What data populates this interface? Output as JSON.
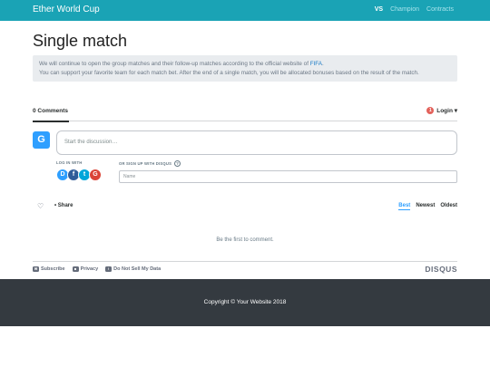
{
  "navbar": {
    "brand": "Ether World Cup",
    "links": [
      {
        "label": "VS",
        "active": true
      },
      {
        "label": "Champion",
        "active": false
      },
      {
        "label": "Contracts",
        "active": false
      }
    ]
  },
  "page": {
    "title": "Single match",
    "notice_line1_prefix": "We will continue to open the group matches and their follow-up matches according to the official website of ",
    "notice_link": "FIFA",
    "notice_line1_suffix": ".",
    "notice_line2": "You can support your favorite team for each match bet. After the end of a single match, you will be allocated bonuses based on the result of the match."
  },
  "disqus": {
    "comment_count": "0 Comments",
    "notification_count": "1",
    "login_label": "Login ▾",
    "avatar_letter": "G",
    "comment_placeholder": "Start the discussion…",
    "login_with_label": "LOG IN WITH",
    "social_icons": {
      "disqus": "D",
      "facebook": "f",
      "twitter": "t",
      "google": "G"
    },
    "signup_label": "OR SIGN UP WITH DISQUS",
    "help_icon": "?",
    "name_placeholder": "Name",
    "heart_icon": "♡",
    "share_label": "Share",
    "share_bullet": "•",
    "sort": {
      "best": "Best",
      "newest": "Newest",
      "oldest": "Oldest"
    },
    "empty_message": "Be the first to comment.",
    "footer": {
      "subscribe": "Subscribe",
      "privacy": "Privacy",
      "do_not_sell": "Do Not Sell My Data",
      "logo": "DISQUS"
    }
  },
  "footer": {
    "copyright": "Copyright © Your Website 2018"
  },
  "colors": {
    "navbar": "#1aa3b5",
    "accent": "#2e9fff",
    "footer": "#343a40"
  }
}
